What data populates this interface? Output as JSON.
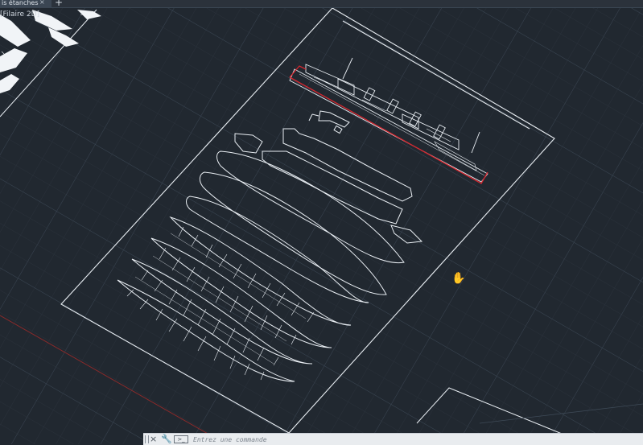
{
  "tabs": [
    {
      "label": "is étanches",
      "close": "×"
    }
  ],
  "new_tab": "+",
  "viewport_label": "[Filaire 2D]",
  "command_line": {
    "close_icon": "×",
    "wrench_icon": "wrench-icon",
    "prompt_icon": ">_",
    "placeholder": "Entrez une commande"
  },
  "colors": {
    "background": "#212830",
    "grid_major": "#3a4653",
    "grid_minor": "#2b333d",
    "drawing": "#e9eef3",
    "highlight": "#d6262e",
    "axis_red": "#8a2a2a"
  },
  "cursor": "hand-pan-icon"
}
